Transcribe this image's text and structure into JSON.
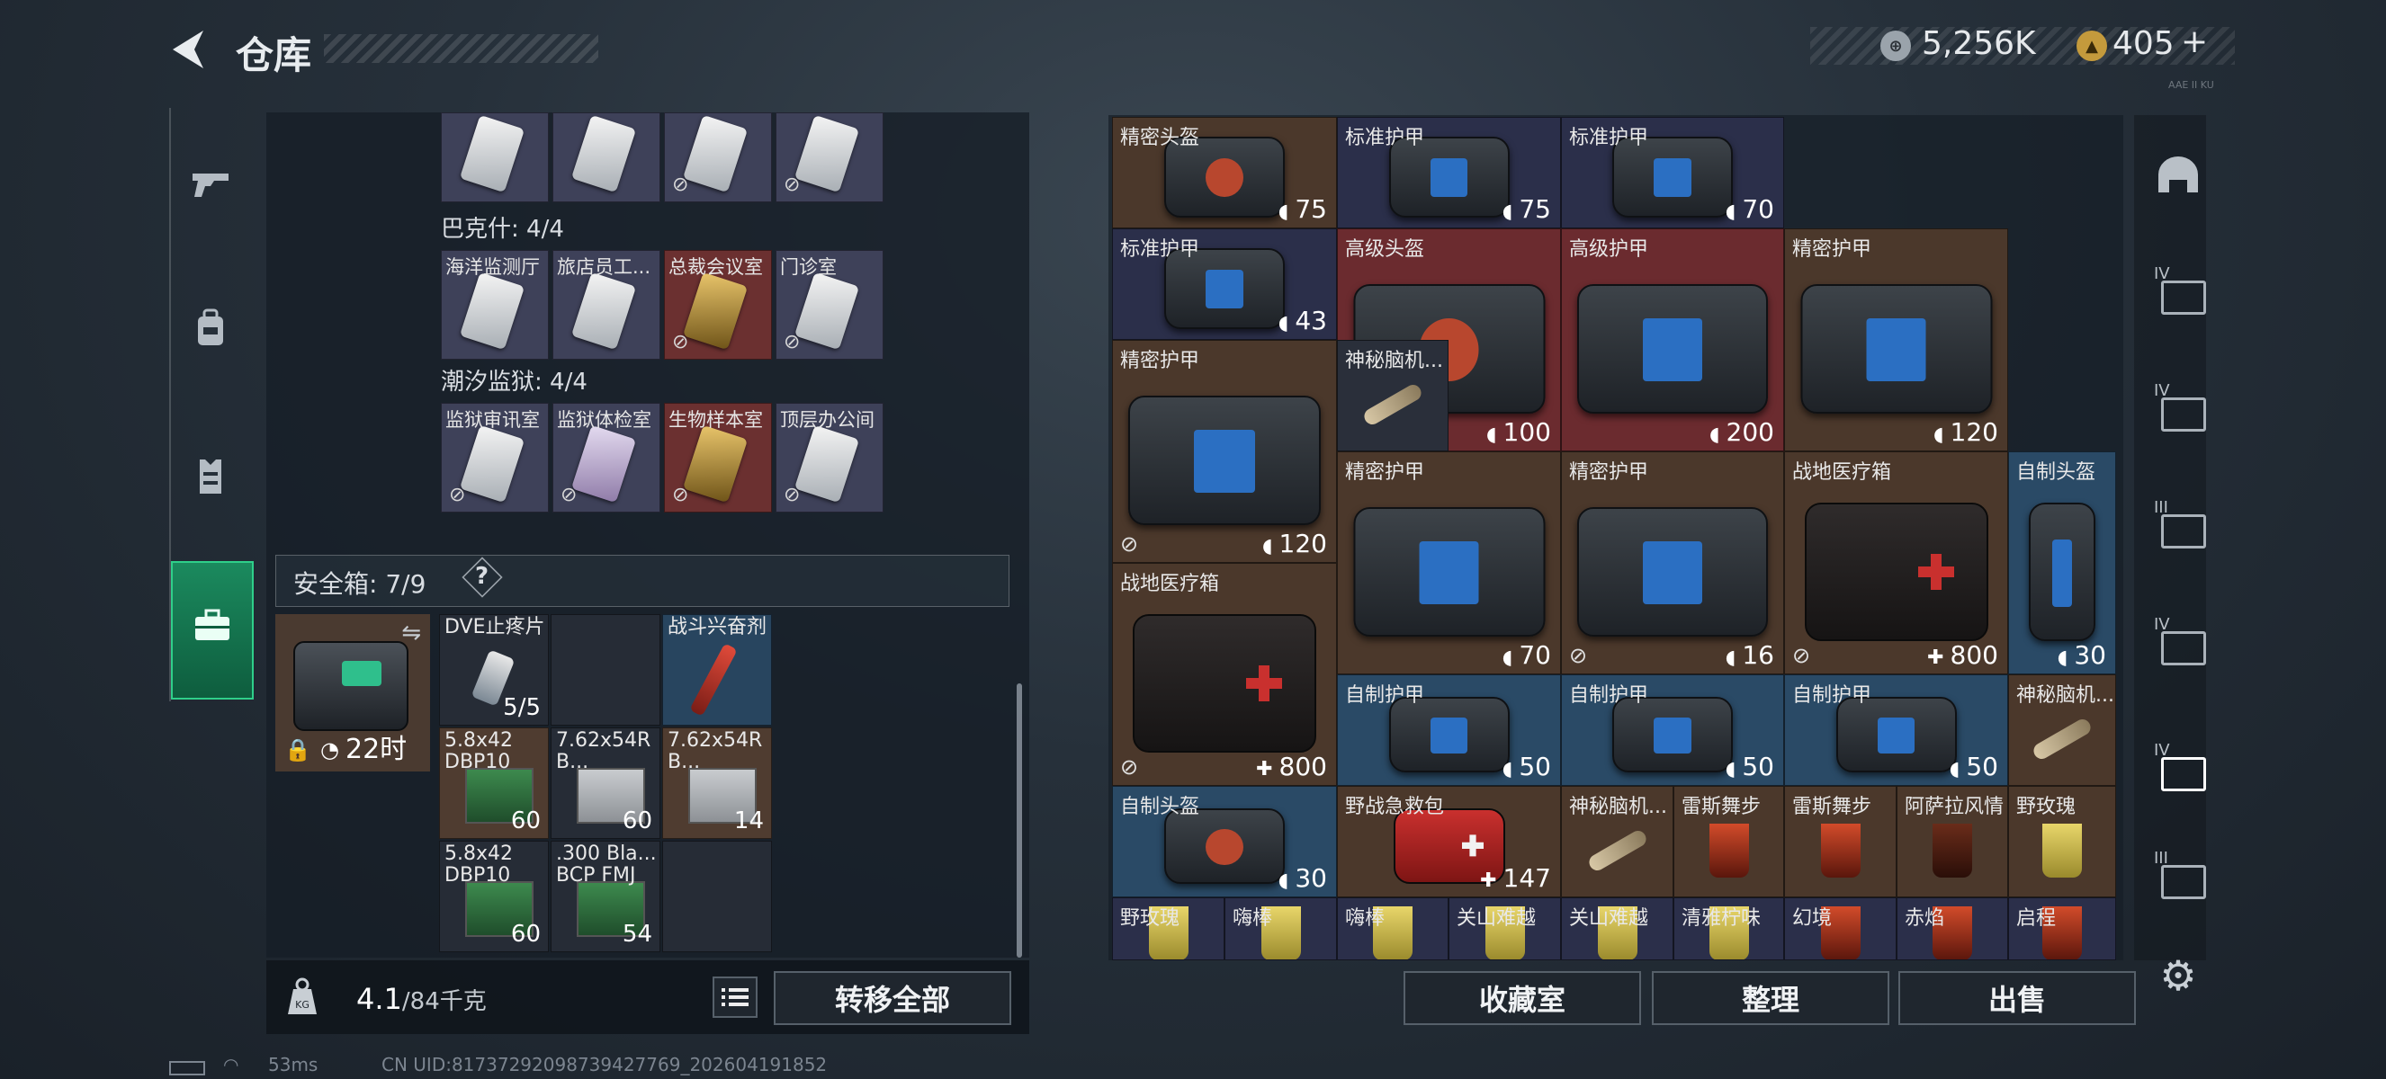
{
  "header": {
    "title": "仓库"
  },
  "currency": {
    "coins": "5,256K",
    "tickets": "405",
    "tickets_plus": "+",
    "tiny_label": "AAE II KU"
  },
  "left_tabs": [
    "gun-icon",
    "backpack-icon",
    "vest-icon",
    "briefcase-icon"
  ],
  "keycard_sections": [
    {
      "title": "",
      "cards": [
        {
          "label": ""
        },
        {
          "label": ""
        },
        {
          "label": ""
        },
        {
          "label": ""
        }
      ]
    },
    {
      "title": "巴克什: 4/4",
      "cards": [
        {
          "label": "海洋监测厅"
        },
        {
          "label": "旅店员工..."
        },
        {
          "label": "总裁会议室"
        },
        {
          "label": "门诊室"
        }
      ]
    },
    {
      "title": "潮汐监狱: 4/4",
      "cards": [
        {
          "label": "监狱审讯室"
        },
        {
          "label": "监狱体检室"
        },
        {
          "label": "生物样本室"
        },
        {
          "label": "顶层办公间"
        }
      ]
    }
  ],
  "safe_box": {
    "title": "安全箱: 7/9",
    "help": "?",
    "timer": "22时",
    "slots": [
      {
        "label": "DVE止疼片",
        "count": "5/5"
      },
      {
        "label": "",
        "count": ""
      },
      {
        "label": "战斗兴奋剂",
        "count": ""
      },
      {
        "label": "5.8x42\nDBP10",
        "count": "60"
      },
      {
        "label": "7.62x54R\nB...",
        "count": "60"
      },
      {
        "label": "7.62x54R\nB...",
        "count": "14"
      },
      {
        "label": "5.8x42\nDBP10",
        "count": "60"
      },
      {
        "label": ".300 Bla...\nBCP FMJ",
        "count": "54"
      },
      {
        "label": "",
        "count": ""
      }
    ]
  },
  "weight": {
    "current": "4.1",
    "max": "/84千克",
    "icon_text": "KG"
  },
  "buttons": {
    "transfer_all": "转移全部",
    "collection": "收藏室",
    "sort": "整理",
    "sell": "出售"
  },
  "grid_items": [
    {
      "label": "精密头盔",
      "value": "75"
    },
    {
      "label": "标准护甲",
      "value": "75"
    },
    {
      "label": "标准护甲",
      "value": "70"
    },
    {
      "label": "标准护甲",
      "value": "43"
    },
    {
      "label": "高级头盔",
      "value": "100"
    },
    {
      "label": "高级护甲",
      "value": "200"
    },
    {
      "label": "精密护甲",
      "value": "120"
    },
    {
      "label": "精密护甲",
      "value": "120"
    },
    {
      "label": "神秘脑机...",
      "value": ""
    },
    {
      "label": "精密护甲",
      "value": "70"
    },
    {
      "label": "精密护甲",
      "value": "16"
    },
    {
      "label": "战地医疗箱",
      "value": "800"
    },
    {
      "label": "自制头盔",
      "value": "30"
    },
    {
      "label": "战地医疗箱",
      "value": "800"
    },
    {
      "label": "自制护甲",
      "value": "50"
    },
    {
      "label": "自制护甲",
      "value": "50"
    },
    {
      "label": "自制护甲",
      "value": "50"
    },
    {
      "label": "神秘脑机...",
      "value": ""
    },
    {
      "label": "自制头盔",
      "value": "30"
    },
    {
      "label": "野战急救包",
      "value": "147"
    },
    {
      "label": "神秘脑机...",
      "value": ""
    },
    {
      "label": "雷斯舞步",
      "value": ""
    },
    {
      "label": "雷斯舞步",
      "value": ""
    },
    {
      "label": "阿萨拉风情",
      "value": ""
    },
    {
      "label": "野玫瑰",
      "value": ""
    },
    {
      "label": "野玫瑰",
      "value": ""
    },
    {
      "label": "嗨棒",
      "value": ""
    },
    {
      "label": "嗨棒",
      "value": ""
    },
    {
      "label": "关山难越",
      "value": ""
    },
    {
      "label": "关山难越",
      "value": ""
    },
    {
      "label": "清雅柠味",
      "value": ""
    },
    {
      "label": "幻境",
      "value": ""
    },
    {
      "label": "赤焰",
      "value": ""
    },
    {
      "label": "启程",
      "value": ""
    }
  ],
  "right_rail": [
    "helmet-icon",
    "IV",
    "IV",
    "III",
    "IV",
    "IV",
    "III"
  ],
  "status": {
    "ping": "53ms",
    "uid": "CN UID:81737292098739427769_202604191852"
  },
  "colors": {
    "accent_green": "#2fcf8a",
    "armor_blue": "#2b6fc2",
    "med_red": "#c9302e"
  }
}
